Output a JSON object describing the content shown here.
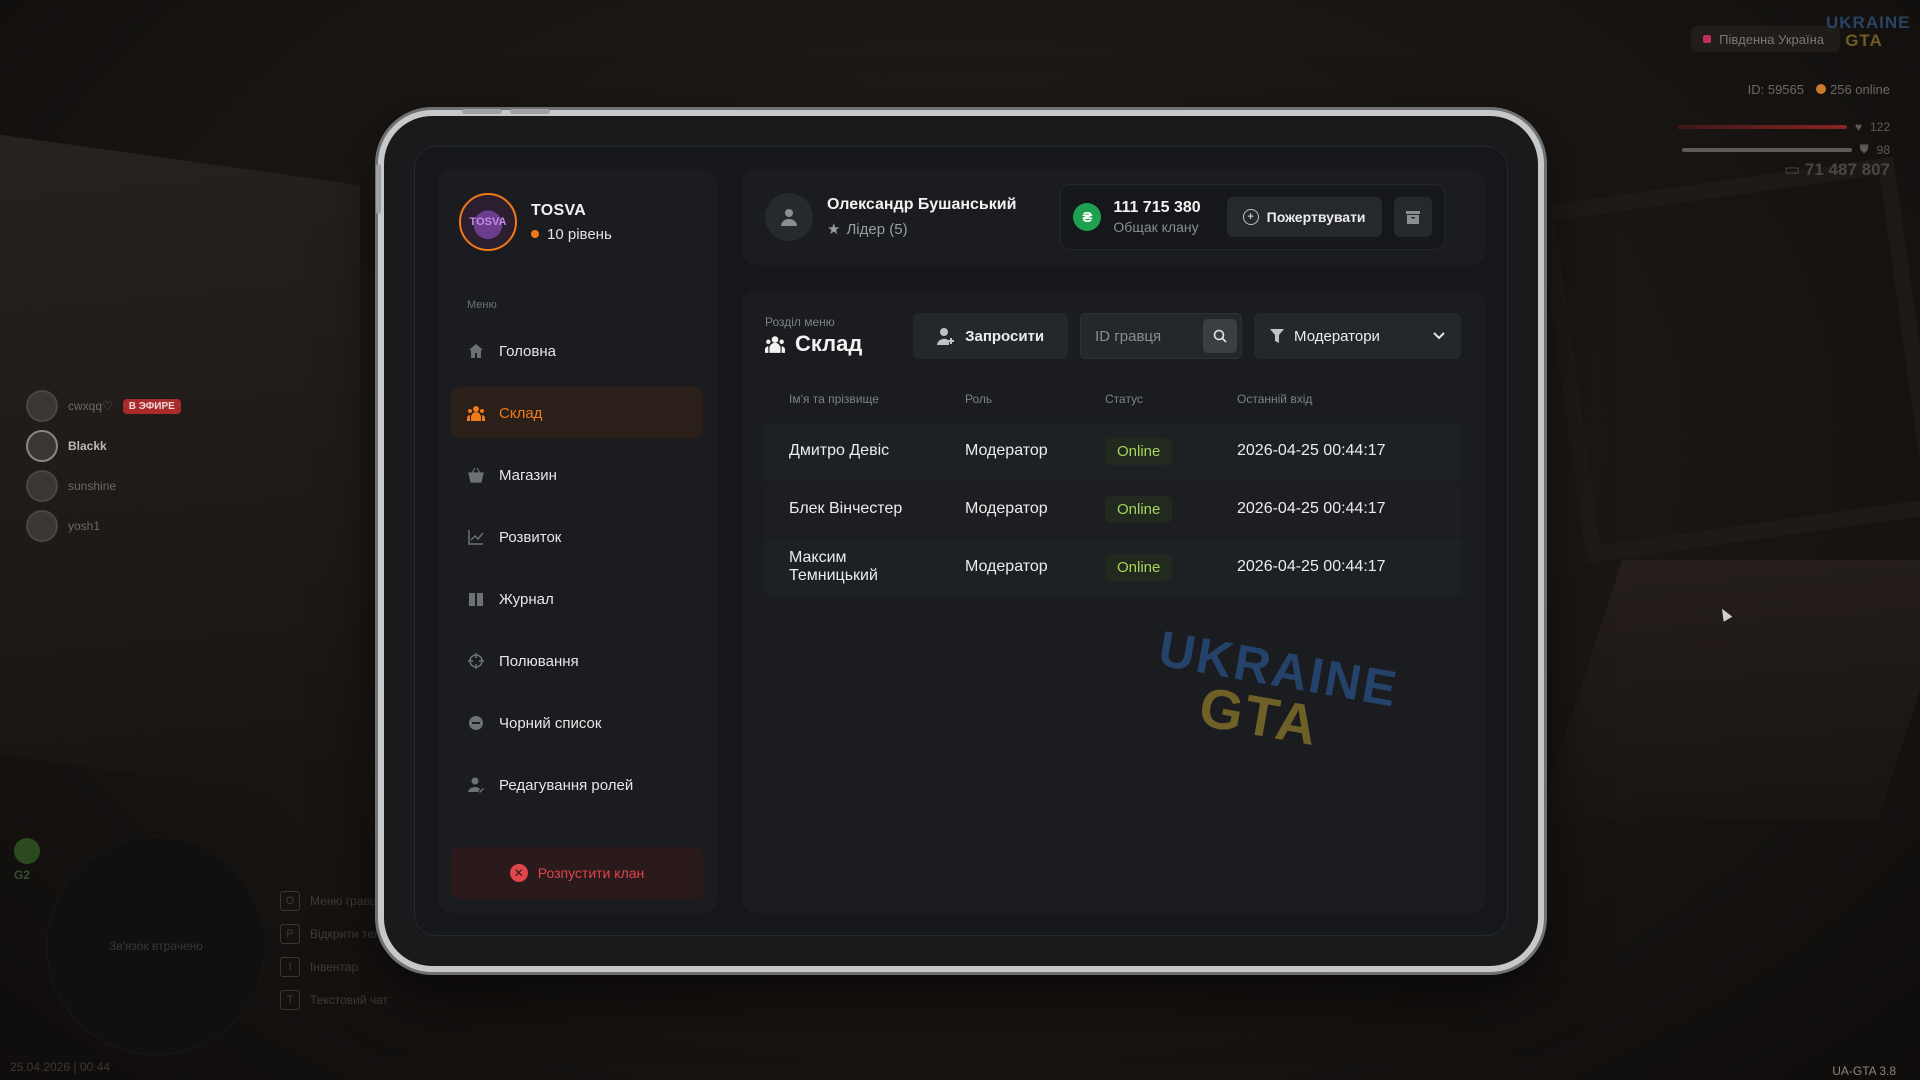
{
  "hud": {
    "region": "Південна Україна",
    "logo_top": "UKRAINE",
    "logo_bottom": "GTA",
    "player_id": "ID: 59565",
    "online": "256 online",
    "health": "122",
    "armor": "98",
    "money": "71 487 807",
    "minimap_text": "Зв'язок втрачено",
    "minimap_level": "G2",
    "date": "25.04.2026 | 00:44",
    "version": "UA-GTA 3.8",
    "voice_live_badge": "В ЭФИРЕ",
    "voice_users": [
      "cwxqq♡",
      "Blackk",
      "sunshine",
      "yosh1"
    ],
    "hints": [
      {
        "key": "O",
        "label": "Меню гравця"
      },
      {
        "key": "P",
        "label": "Відкрити телефон"
      },
      {
        "key": "I",
        "label": "Інвентар"
      },
      {
        "key": "T",
        "label": "Текстовий чат"
      }
    ]
  },
  "clan": {
    "name": "TOSVA",
    "level": "10 рівень",
    "avatar_text": "TOSVA"
  },
  "menu": {
    "caption": "Меню",
    "items": [
      {
        "label": "Головна",
        "icon": "home-icon"
      },
      {
        "label": "Склад",
        "icon": "users-icon"
      },
      {
        "label": "Магазин",
        "icon": "basket-icon"
      },
      {
        "label": "Розвиток",
        "icon": "chart-icon"
      },
      {
        "label": "Журнал",
        "icon": "book-icon"
      },
      {
        "label": "Полювання",
        "icon": "crosshair-icon"
      },
      {
        "label": "Чорний список",
        "icon": "block-icon"
      },
      {
        "label": "Редагування ролей",
        "icon": "user-edit-icon"
      }
    ],
    "active_index": 1,
    "disband_label": "Розпустити клан"
  },
  "header": {
    "user_name": "Олександр Бушанський",
    "user_role": "Лідер (5)",
    "bank_value": "111 715 380",
    "bank_label": "Общак клану",
    "donate_label": "Пожертвувати"
  },
  "section": {
    "caption": "Розділ меню",
    "title": "Склад",
    "invite_label": "Запросити",
    "search_placeholder": "ID гравця",
    "filter_label": "Модератори"
  },
  "table": {
    "headers": [
      "Ім'я та прізвище",
      "Роль",
      "Статус",
      "Останній вхід"
    ],
    "rows": [
      {
        "name": "Дмитро Девіс",
        "role": "Модератор",
        "status": "Online",
        "last_login": "2026-04-25 00:44:17"
      },
      {
        "name": "Блек Вінчестер",
        "role": "Модератор",
        "status": "Online",
        "last_login": "2026-04-25 00:44:17"
      },
      {
        "name": "Максим Темницький",
        "role": "Модератор",
        "status": "Online",
        "last_login": "2026-04-25 00:44:17"
      }
    ]
  },
  "watermark": {
    "top": "UKRAINE",
    "bottom": "GTA"
  },
  "colors": {
    "accent": "#f07a1a",
    "danger": "#e0454b",
    "online": "#a6d45b",
    "bank": "#1ea050"
  }
}
